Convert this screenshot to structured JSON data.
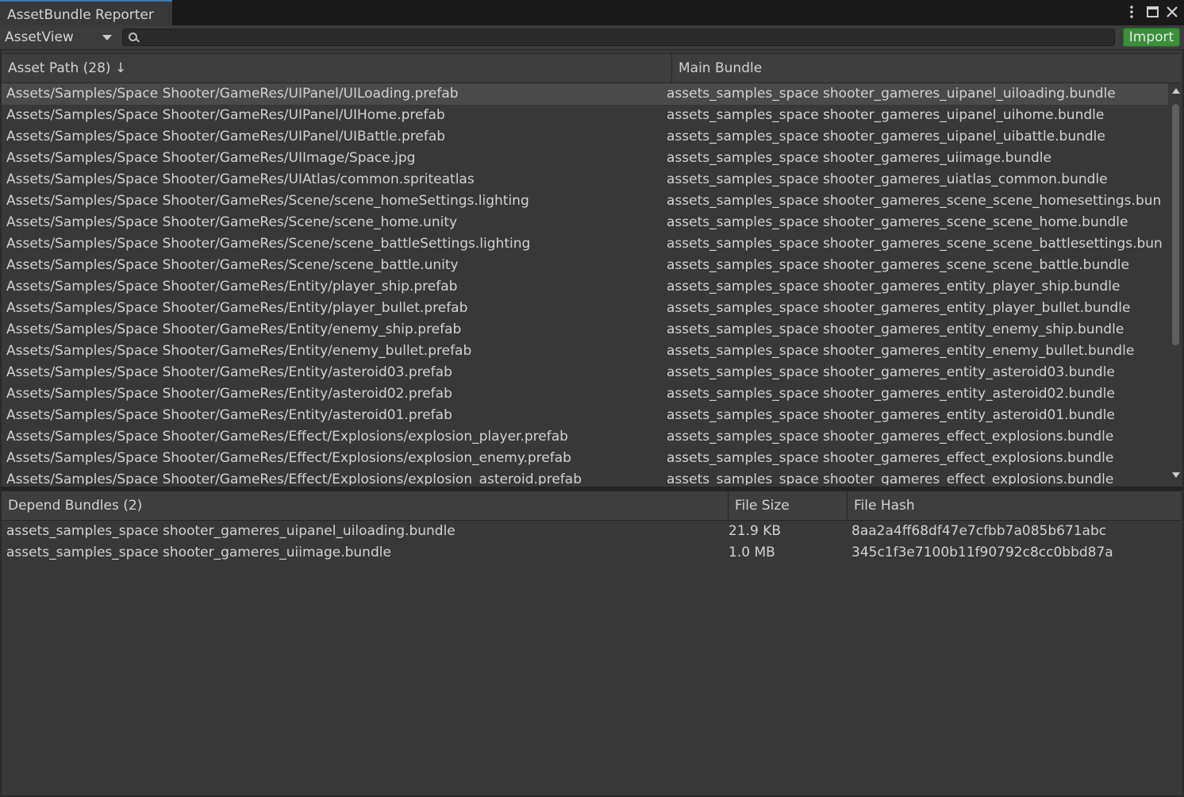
{
  "window": {
    "tab_title": "AssetBundle Reporter",
    "menu_icon": "kebab-menu-icon",
    "maximize_icon": "maximize-icon",
    "close_icon": "close-icon"
  },
  "toolbar": {
    "view_selected": "AssetView",
    "search_value": "",
    "import_label": "Import",
    "import_color": "#3a8f3a"
  },
  "asset_table": {
    "columns": [
      "Asset Path (28) ↓",
      "Main Bundle"
    ],
    "selected_index": 0,
    "rows": [
      {
        "path": "Assets/Samples/Space Shooter/GameRes/UIPanel/UILoading.prefab",
        "bundle": "assets_samples_space shooter_gameres_uipanel_uiloading.bundle"
      },
      {
        "path": "Assets/Samples/Space Shooter/GameRes/UIPanel/UIHome.prefab",
        "bundle": "assets_samples_space shooter_gameres_uipanel_uihome.bundle"
      },
      {
        "path": "Assets/Samples/Space Shooter/GameRes/UIPanel/UIBattle.prefab",
        "bundle": "assets_samples_space shooter_gameres_uipanel_uibattle.bundle"
      },
      {
        "path": "Assets/Samples/Space Shooter/GameRes/UIImage/Space.jpg",
        "bundle": "assets_samples_space shooter_gameres_uiimage.bundle"
      },
      {
        "path": "Assets/Samples/Space Shooter/GameRes/UIAtlas/common.spriteatlas",
        "bundle": "assets_samples_space shooter_gameres_uiatlas_common.bundle"
      },
      {
        "path": "Assets/Samples/Space Shooter/GameRes/Scene/scene_homeSettings.lighting",
        "bundle": "assets_samples_space shooter_gameres_scene_scene_homesettings.bun"
      },
      {
        "path": "Assets/Samples/Space Shooter/GameRes/Scene/scene_home.unity",
        "bundle": "assets_samples_space shooter_gameres_scene_scene_home.bundle"
      },
      {
        "path": "Assets/Samples/Space Shooter/GameRes/Scene/scene_battleSettings.lighting",
        "bundle": "assets_samples_space shooter_gameres_scene_scene_battlesettings.bun"
      },
      {
        "path": "Assets/Samples/Space Shooter/GameRes/Scene/scene_battle.unity",
        "bundle": "assets_samples_space shooter_gameres_scene_scene_battle.bundle"
      },
      {
        "path": "Assets/Samples/Space Shooter/GameRes/Entity/player_ship.prefab",
        "bundle": "assets_samples_space shooter_gameres_entity_player_ship.bundle"
      },
      {
        "path": "Assets/Samples/Space Shooter/GameRes/Entity/player_bullet.prefab",
        "bundle": "assets_samples_space shooter_gameres_entity_player_bullet.bundle"
      },
      {
        "path": "Assets/Samples/Space Shooter/GameRes/Entity/enemy_ship.prefab",
        "bundle": "assets_samples_space shooter_gameres_entity_enemy_ship.bundle"
      },
      {
        "path": "Assets/Samples/Space Shooter/GameRes/Entity/enemy_bullet.prefab",
        "bundle": "assets_samples_space shooter_gameres_entity_enemy_bullet.bundle"
      },
      {
        "path": "Assets/Samples/Space Shooter/GameRes/Entity/asteroid03.prefab",
        "bundle": "assets_samples_space shooter_gameres_entity_asteroid03.bundle"
      },
      {
        "path": "Assets/Samples/Space Shooter/GameRes/Entity/asteroid02.prefab",
        "bundle": "assets_samples_space shooter_gameres_entity_asteroid02.bundle"
      },
      {
        "path": "Assets/Samples/Space Shooter/GameRes/Entity/asteroid01.prefab",
        "bundle": "assets_samples_space shooter_gameres_entity_asteroid01.bundle"
      },
      {
        "path": "Assets/Samples/Space Shooter/GameRes/Effect/Explosions/explosion_player.prefab",
        "bundle": "assets_samples_space shooter_gameres_effect_explosions.bundle"
      },
      {
        "path": "Assets/Samples/Space Shooter/GameRes/Effect/Explosions/explosion_enemy.prefab",
        "bundle": "assets_samples_space shooter_gameres_effect_explosions.bundle"
      },
      {
        "path": "Assets/Samples/Space Shooter/GameRes/Effect/Explosions/explosion_asteroid.prefab",
        "bundle": "assets_samples_space shooter_gameres_effect_explosions.bundle"
      }
    ]
  },
  "depend_table": {
    "columns": [
      "Depend Bundles (2)",
      "File Size",
      "File Hash"
    ],
    "rows": [
      {
        "bundle": "assets_samples_space shooter_gameres_uipanel_uiloading.bundle",
        "size": "21.9 KB",
        "hash": "8aa2a4ff68df47e7cfbb7a085b671abc"
      },
      {
        "bundle": "assets_samples_space shooter_gameres_uiimage.bundle",
        "size": "1.0 MB",
        "hash": "345c1f3e7100b11f90792c8cc0bbd87a"
      }
    ]
  },
  "colors": {
    "background": "#383838",
    "header": "#3e3e3e",
    "selected_row": "#4a4a4a",
    "tab_accent": "#3a79bb"
  }
}
